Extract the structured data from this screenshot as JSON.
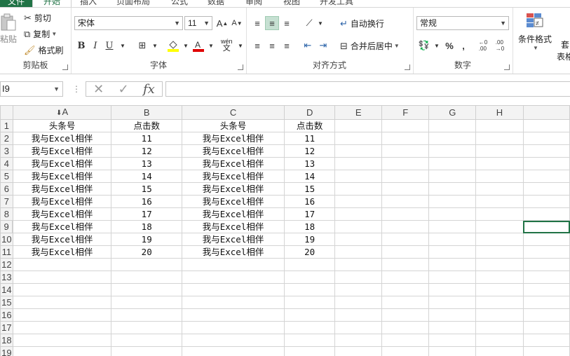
{
  "tabs": [
    {
      "label": "文件"
    },
    {
      "label": "开始"
    },
    {
      "label": "插入"
    },
    {
      "label": "页面布局"
    },
    {
      "label": "公式"
    },
    {
      "label": "数据"
    },
    {
      "label": "审阅"
    },
    {
      "label": "视图"
    },
    {
      "label": "开发工具"
    }
  ],
  "ribbon": {
    "clipboard": {
      "label": "剪贴板",
      "paste": "粘贴",
      "cut": "剪切",
      "copy": "复制",
      "format_painter": "格式刷"
    },
    "font": {
      "label": "字体",
      "name": "宋体",
      "size": "11",
      "bold": "B",
      "italic": "I",
      "underline": "U",
      "pinyin_top": "wén",
      "pinyin_bottom": "文"
    },
    "alignment": {
      "label": "对齐方式",
      "wrap": "自动换行",
      "merge": "合并后居中"
    },
    "number": {
      "label": "数字",
      "format": "常规",
      "percent": "%",
      "comma": ","
    },
    "styles": {
      "conditional": "条件格式",
      "table_partial": "套",
      "table_format_partial": "表格"
    }
  },
  "formula_bar": {
    "name_box": "I9",
    "fx": "fx",
    "value": ""
  },
  "accent": "#217346",
  "columns": [
    "A",
    "B",
    "C",
    "D",
    "E",
    "F",
    "G",
    "H"
  ],
  "rows": [
    {
      "n": "1",
      "c": [
        "头条号",
        "点击数",
        "头条号",
        "点击数",
        "",
        "",
        "",
        ""
      ]
    },
    {
      "n": "2",
      "c": [
        "我与Excel相伴",
        "11",
        "我与Excel相伴",
        "11",
        "",
        "",
        "",
        ""
      ]
    },
    {
      "n": "3",
      "c": [
        "我与Excel相伴",
        "12",
        "我与Excel相伴",
        "12",
        "",
        "",
        "",
        ""
      ]
    },
    {
      "n": "4",
      "c": [
        "我与Excel相伴",
        "13",
        "我与Excel相伴",
        "13",
        "",
        "",
        "",
        ""
      ]
    },
    {
      "n": "5",
      "c": [
        "我与Excel相伴",
        "14",
        "我与Excel相伴",
        "14",
        "",
        "",
        "",
        ""
      ]
    },
    {
      "n": "6",
      "c": [
        "我与Excel相伴",
        "15",
        "我与Excel相伴",
        "15",
        "",
        "",
        "",
        ""
      ]
    },
    {
      "n": "7",
      "c": [
        "我与Excel相伴",
        "16",
        "我与Excel相伴",
        "16",
        "",
        "",
        "",
        ""
      ]
    },
    {
      "n": "8",
      "c": [
        "我与Excel相伴",
        "17",
        "我与Excel相伴",
        "17",
        "",
        "",
        "",
        ""
      ]
    },
    {
      "n": "9",
      "c": [
        "我与Excel相伴",
        "18",
        "我与Excel相伴",
        "18",
        "",
        "",
        "",
        ""
      ]
    },
    {
      "n": "10",
      "c": [
        "我与Excel相伴",
        "19",
        "我与Excel相伴",
        "19",
        "",
        "",
        "",
        ""
      ]
    },
    {
      "n": "11",
      "c": [
        "我与Excel相伴",
        "20",
        "我与Excel相伴",
        "20",
        "",
        "",
        "",
        ""
      ]
    },
    {
      "n": "12",
      "c": [
        "",
        "",
        "",
        "",
        "",
        "",
        "",
        ""
      ]
    },
    {
      "n": "13",
      "c": [
        "",
        "",
        "",
        "",
        "",
        "",
        "",
        ""
      ]
    },
    {
      "n": "14",
      "c": [
        "",
        "",
        "",
        "",
        "",
        "",
        "",
        ""
      ]
    },
    {
      "n": "15",
      "c": [
        "",
        "",
        "",
        "",
        "",
        "",
        "",
        ""
      ]
    },
    {
      "n": "16",
      "c": [
        "",
        "",
        "",
        "",
        "",
        "",
        "",
        ""
      ]
    },
    {
      "n": "17",
      "c": [
        "",
        "",
        "",
        "",
        "",
        "",
        "",
        ""
      ]
    },
    {
      "n": "18",
      "c": [
        "",
        "",
        "",
        "",
        "",
        "",
        "",
        ""
      ]
    },
    {
      "n": "19",
      "c": [
        "",
        "",
        "",
        "",
        "",
        "",
        "",
        ""
      ]
    }
  ]
}
